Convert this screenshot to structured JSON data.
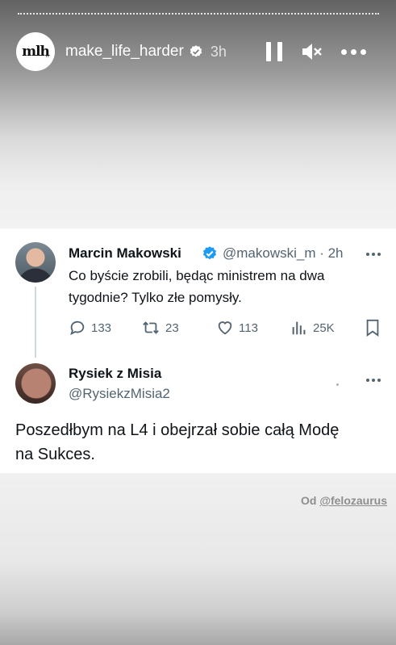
{
  "story": {
    "username": "make_life_harder",
    "time": "3h",
    "avatar_text": "mlh",
    "credit_prefix": "Od",
    "credit_handle": "@felozaurus"
  },
  "tweet": {
    "author_name": "Marcin Makowski",
    "handle_time": "@makowski_m · 2h",
    "text_line1": "Co byście zrobili, będąc ministrem na dwa",
    "text_line2": "tygodnie? Tylko złe pomysły.",
    "replies": "133",
    "retweets": "23",
    "likes": "113",
    "views": "25K"
  },
  "reply": {
    "author_name": "Rysiek z Misia",
    "handle": "@RysiekzMisia2",
    "text_line1": "Poszedłbym na L4 i obejrzał sobie całą Modę",
    "text_line2": "na Sukces."
  },
  "colors": {
    "verified_blue": "#1d9bf0",
    "secondary_text": "#536471",
    "thread_line": "#cfd9de"
  },
  "icons": [
    "verified-icon",
    "pause-icon",
    "mute-icon",
    "more-icon",
    "reply-icon",
    "retweet-icon",
    "like-icon",
    "views-icon",
    "bookmark-icon"
  ]
}
